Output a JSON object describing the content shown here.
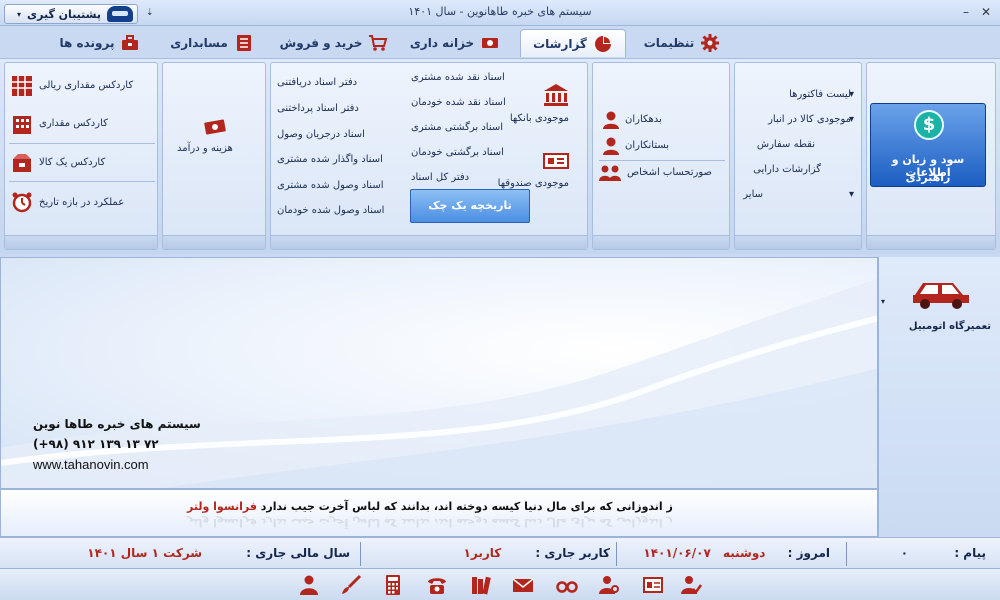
{
  "window": {
    "title": "سیستم های خبره طاهانوین - سال ۱۴۰۱",
    "minimize": "–",
    "close": "✕"
  },
  "qat": {
    "backup_label": "پشتیبان گیری",
    "caret": "▾",
    "more": "⇣"
  },
  "tabs": [
    {
      "label": "تنظیمات",
      "icon": "gear-icon"
    },
    {
      "label": "گزارشات",
      "icon": "pie-chart-icon",
      "active": true
    },
    {
      "label": "خزانه داری",
      "icon": "cash-icon"
    },
    {
      "label": "خرید و فروش",
      "icon": "cart-icon"
    },
    {
      "label": "مسابداری",
      "icon": "ledger-icon"
    },
    {
      "label": "پرونده ها",
      "icon": "toolbox-icon"
    }
  ],
  "ribbon": {
    "main_report": {
      "symbol": "$",
      "line1": "سود و زیان و اطلاعات",
      "line2": "راهبردی"
    },
    "reports_list": [
      "لیست فاکتورها",
      "موجودی کالا در انبار",
      "نقطه سفارش",
      "گزارشات دارایی",
      "سایر"
    ],
    "persons": [
      "بدهکاران",
      "بستانکاران",
      "صورتحساب اشخاص"
    ],
    "banks": {
      "banks_label": "موجودی بانکها",
      "boxes_label": "موجودی صندوقها"
    },
    "cheques_col1": [
      "اسناد نقد شده مشتری",
      "اسناد نقد شده خودمان",
      "اسناد برگشتی مشتری",
      "اسناد برگشتی خودمان",
      "دفتر کل اسناد"
    ],
    "cheque_history_btn": "تاریخچه یک چک",
    "cheques_col2": [
      "دفتر اسناد دریافتنی",
      "دفتر اسناد پرداختنی",
      "اسناد درجریان وصول",
      "اسناد واگذار شده مشتری",
      "اسناد وصول شده مشتری",
      "اسناد وصول شده خودمان"
    ],
    "expense_label": "هزینه و درآمد",
    "inventory": [
      "کاردکس مقداری ریالی",
      "کاردکس مقداری",
      "کاردکس یک کالا",
      "عملکرد در بازه تاریخ"
    ],
    "caret": "▾"
  },
  "main": {
    "company_line": "سیستم های خبره طاها نوین",
    "phone": "(+۹۸) ۹۱۲ ۱۳۹ ۱۳ ۷۲",
    "website": "www.tahanovin.com"
  },
  "side": {
    "label": "تعمیرگاه اتومبیل",
    "caret": "▾"
  },
  "quote": {
    "text": "ز اندوزانی که برای مال دنیا کیسه دوخته اند، بدانند که لباس آخرت جیب ندارد",
    "author": "فرانسوا ولتر"
  },
  "status": {
    "message_label": "پیام :",
    "message_value": "۰",
    "today_label": "امروز :",
    "today_day": "دوشنبه",
    "today_date": "۱۴۰۱/۰۶/۰۷",
    "user_label": "کاربر جاری :",
    "user_value": "کاربر۱",
    "year_label": "سال مالی جاری :",
    "year_value": "شرکت ۱ سال ۱۴۰۱"
  },
  "colors": {
    "accent": "#b3261e",
    "primary": "#1c5ec2",
    "ribbon": "#dde8f8"
  }
}
